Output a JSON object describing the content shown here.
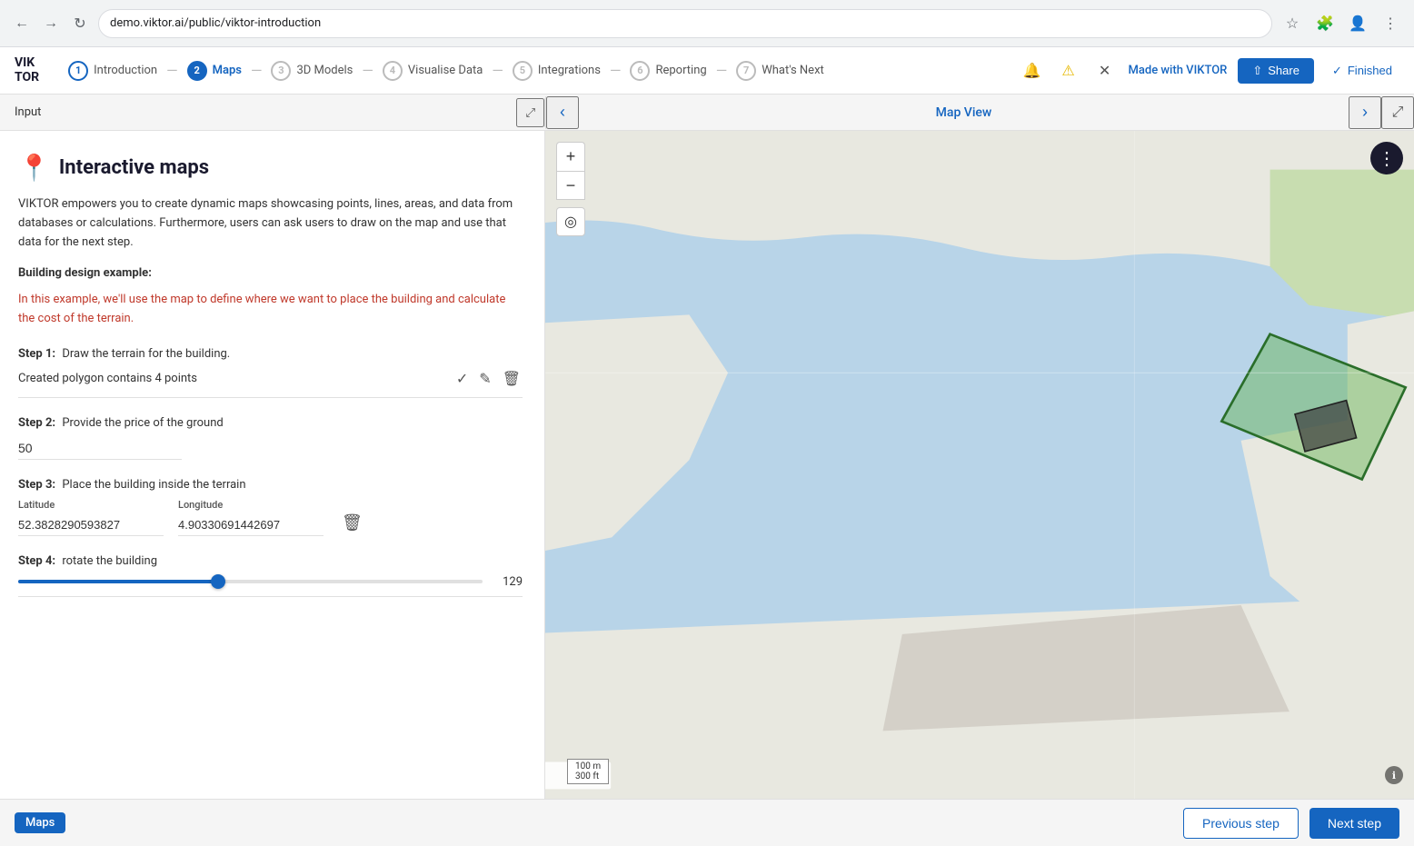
{
  "browser": {
    "url": "demo.viktor.ai/public/viktor-introduction",
    "back_icon": "◀",
    "forward_icon": "▶",
    "refresh_icon": "↻"
  },
  "header": {
    "logo_line1": "VIK",
    "logo_line2": "TOR",
    "made_with_label": "Made with ",
    "made_with_brand": "VIKTOR",
    "share_label": "Share",
    "finished_label": "Finished",
    "nav_steps": [
      {
        "num": "1",
        "label": "Introduction",
        "state": "completed"
      },
      {
        "num": "2",
        "label": "Maps",
        "state": "active"
      },
      {
        "num": "3",
        "label": "3D Models",
        "state": "default"
      },
      {
        "num": "4",
        "label": "Visualise Data",
        "state": "default"
      },
      {
        "num": "5",
        "label": "Integrations",
        "state": "default"
      },
      {
        "num": "6",
        "label": "Reporting",
        "state": "default"
      },
      {
        "num": "7",
        "label": "What's Next",
        "state": "default"
      }
    ]
  },
  "sub_header": {
    "input_label": "Input",
    "panel_title": "Map View"
  },
  "left_panel": {
    "title": "Interactive maps",
    "description": "VIKTOR empowers you to create dynamic maps showcasing points, lines, areas, and data from databases or calculations. Furthermore, users can ask users to draw on the map and use that data for the next step.",
    "building_design_label": "Building design example:",
    "example_text": "In this example, we'll use the map to define where we want to place the building and calculate the cost of the terrain.",
    "steps": [
      {
        "key": "Step 1:",
        "text": "Draw the terrain for the building.",
        "polygon_label": "Created polygon contains 4 points"
      },
      {
        "key": "Step 2:",
        "text": "Provide the price of the ground",
        "value": "50"
      },
      {
        "key": "Step 3:",
        "text": "Place the building inside the terrain",
        "latitude_label": "Latitude",
        "longitude_label": "Longitude",
        "latitude_value": "52.3828290593827",
        "longitude_value": "4.90330691442697"
      },
      {
        "key": "Step 4:",
        "text": "rotate the building",
        "slider_value": "129",
        "slider_percent": 0.43
      }
    ]
  },
  "footer": {
    "tag_label": "Maps",
    "prev_label": "Previous step",
    "next_label": "Next step"
  },
  "map": {
    "scale_label": "100 m",
    "scale_label2": "300 ft"
  }
}
